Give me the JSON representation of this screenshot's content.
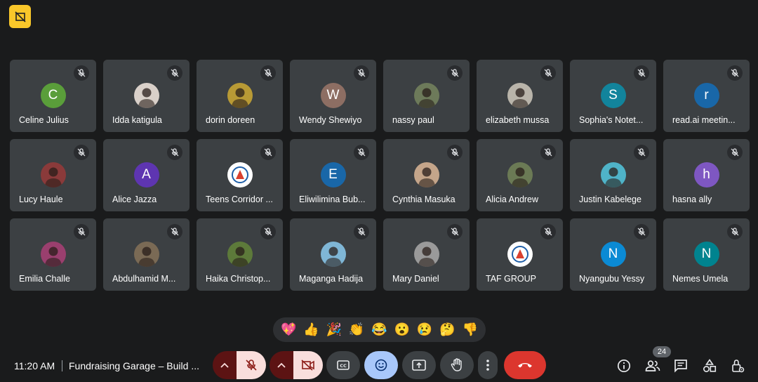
{
  "colors": {
    "background": "#1a1b1c",
    "tile": "#3c4043",
    "accent_yellow": "#f9c72a",
    "end_call": "#dc362e",
    "muted_red": "#f9dedc",
    "reactions_active": "#a8c7fa"
  },
  "participants": [
    {
      "name": "Celine Julius",
      "initial": "C",
      "avatar": "letter",
      "color": "#5a9e3a"
    },
    {
      "name": "Idda katigula",
      "initial": "",
      "avatar": "photo",
      "color": "#d9d0c9"
    },
    {
      "name": "dorin doreen",
      "initial": "",
      "avatar": "photo",
      "color": "#b89a35"
    },
    {
      "name": "Wendy Shewiyo",
      "initial": "W",
      "avatar": "letter",
      "color": "#8d6e63"
    },
    {
      "name": "nassy paul",
      "initial": "",
      "avatar": "photo",
      "color": "#6d7a5a"
    },
    {
      "name": "elizabeth mussa",
      "initial": "",
      "avatar": "photo",
      "color": "#b9b4aa"
    },
    {
      "name": "Sophia's Notet...",
      "initial": "S",
      "avatar": "letter",
      "color": "#12849c"
    },
    {
      "name": "read.ai meetin...",
      "initial": "r",
      "avatar": "letter",
      "color": "#1967a8"
    },
    {
      "name": "Lucy Haule",
      "initial": "",
      "avatar": "photo",
      "color": "#8a3a3a"
    },
    {
      "name": "Alice Jazza",
      "initial": "A",
      "avatar": "letter",
      "color": "#5e35b1"
    },
    {
      "name": "Teens Corridor ...",
      "initial": "",
      "avatar": "logo",
      "color": "#ffffff"
    },
    {
      "name": "Eliwilimina Bub...",
      "initial": "E",
      "avatar": "letter",
      "color": "#1967a8"
    },
    {
      "name": "Cynthia Masuka",
      "initial": "",
      "avatar": "photo",
      "color": "#c4a58a"
    },
    {
      "name": "Alicia Andrew",
      "initial": "",
      "avatar": "photo",
      "color": "#6b7a55"
    },
    {
      "name": "Justin Kabelege",
      "initial": "",
      "avatar": "photo",
      "color": "#4fb3c8"
    },
    {
      "name": "hasna ally",
      "initial": "h",
      "avatar": "letter",
      "color": "#7e57c2"
    },
    {
      "name": "Emilia Challe",
      "initial": "",
      "avatar": "photo",
      "color": "#9a3f6e"
    },
    {
      "name": "Abdulhamid M...",
      "initial": "",
      "avatar": "photo",
      "color": "#7a6a55"
    },
    {
      "name": "Haika Christop...",
      "initial": "",
      "avatar": "photo",
      "color": "#5d7a3a"
    },
    {
      "name": "Maganga Hadija",
      "initial": "",
      "avatar": "photo",
      "color": "#7fb6d6"
    },
    {
      "name": "Mary Daniel",
      "initial": "",
      "avatar": "photo",
      "color": "#9a9a9a"
    },
    {
      "name": "TAF GROUP",
      "initial": "",
      "avatar": "logo",
      "color": "#ffffff"
    },
    {
      "name": "Nyangubu Yessy",
      "initial": "N",
      "avatar": "letter",
      "color": "#0b8ad4"
    },
    {
      "name": "Nemes Umela",
      "initial": "N",
      "avatar": "letter",
      "color": "#00838f"
    }
  ],
  "reactions": [
    "💖",
    "👍",
    "🎉",
    "👏",
    "😂",
    "😮",
    "😢",
    "🤔",
    "👎"
  ],
  "bottombar": {
    "time": "11:20 AM",
    "meeting_title": "Fundraising Garage – Build ...",
    "participant_count": "24"
  },
  "icons": {
    "top_badge": "no-video-icon",
    "tile_mute": "mic-off-icon",
    "controls": [
      "chevron-up-icon",
      "mic-off-icon",
      "chevron-up-icon",
      "camera-off-icon",
      "captions-icon",
      "emoji-icon",
      "present-screen-icon",
      "raise-hand-icon",
      "more-vert-icon",
      "end-call-icon"
    ],
    "right": [
      "info-icon",
      "people-icon",
      "chat-icon",
      "activities-icon",
      "host-controls-icon"
    ]
  }
}
